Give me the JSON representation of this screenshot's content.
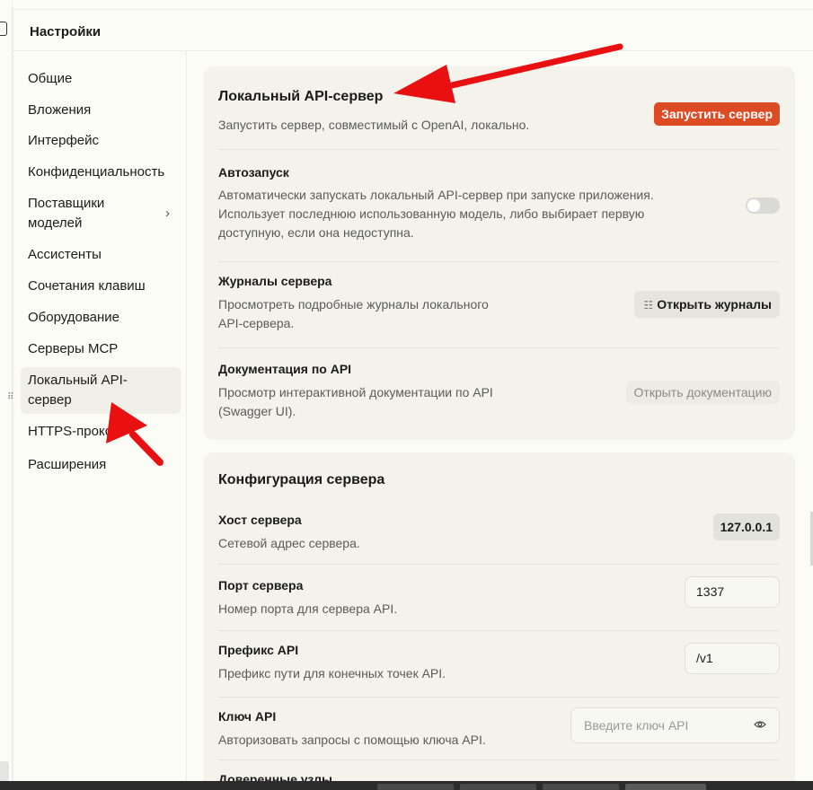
{
  "window": {
    "title": "Настройки"
  },
  "sidebar": {
    "items": [
      {
        "label": "Общие"
      },
      {
        "label": "Вложения"
      },
      {
        "label": "Интерфейс"
      },
      {
        "label": "Конфиденциальность"
      },
      {
        "label": "Поставщики моделей",
        "line1": "Поставщики",
        "line2": "моделей",
        "chevron": "›"
      },
      {
        "label": "Ассистенты"
      },
      {
        "label": "Сочетания клавиш"
      },
      {
        "label": "Оборудование"
      },
      {
        "label": "Серверы MCP"
      },
      {
        "label": "Локальный API-сервер",
        "line1": "Локальный API-",
        "line2": "сервер",
        "active": true
      },
      {
        "label": "HTTPS-прокси"
      },
      {
        "label": "Расширения"
      }
    ]
  },
  "server": {
    "title": "Локальный API-сервер",
    "description": "Запустить сервер, совместимый с OpenAI, локально.",
    "start_label": "Запустить сервер",
    "autostart": {
      "title": "Автозапуск",
      "description_lines": [
        "Автоматически запускать локальный API-сервер при запуске приложения.",
        "Использует последнюю использованную модель, либо выбирает первую",
        "доступную, если она недоступна."
      ],
      "enabled": false
    },
    "logs": {
      "title": "Журналы сервера",
      "description_lines": [
        "Просмотреть подробные журналы локального",
        "API-сервера."
      ],
      "button_label": "Открыть журналы",
      "button_icon": "list-icon"
    },
    "docs": {
      "title": "Документация по API",
      "description_lines": [
        "Просмотр интерактивной документации по API",
        "(Swagger UI)."
      ],
      "button_label": "Открыть документацию"
    }
  },
  "config": {
    "title": "Конфигурация сервера",
    "host": {
      "title": "Хост сервера",
      "description": "Сетевой адрес сервера.",
      "value": "127.0.0.1"
    },
    "port": {
      "title": "Порт сервера",
      "description": "Номер порта для сервера API.",
      "value": "1337"
    },
    "prefix": {
      "title": "Префикс API",
      "description": "Префикс пути для конечных точек API.",
      "value": "/v1"
    },
    "api_key": {
      "title": "Ключ API",
      "description": "Авторизовать запросы с помощью ключа API.",
      "placeholder": "Введите ключ API",
      "icon": "eye-icon"
    },
    "trusted_hosts": {
      "title": "Доверенные узлы"
    }
  },
  "colors": {
    "accent": "#dc4b23",
    "annotation": "#e81010",
    "card": "#f3f3ec",
    "background": "#fcfcf7"
  }
}
